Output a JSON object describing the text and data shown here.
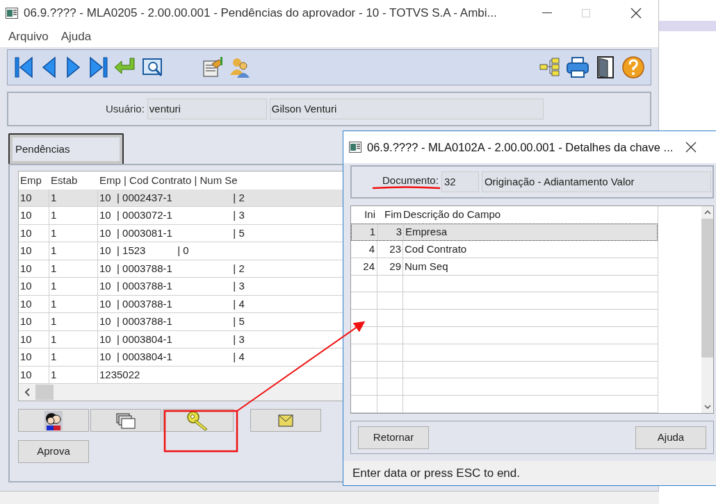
{
  "main_window": {
    "title": "06.9.???? - MLA0205 - 2.00.00.001 - Pendências do aprovador - 10 - TOTVS S.A - Ambi...",
    "menu": [
      "Arquivo",
      "Ajuda"
    ],
    "user": {
      "label": "Usuário:",
      "login": "venturi",
      "name": "Gilson Venturi"
    },
    "tabs": [
      {
        "label": "Pendências",
        "selected": true
      }
    ],
    "grid": {
      "columns": [
        "Emp",
        "Estab",
        "Emp | Cod Contrato | Num Se"
      ],
      "rows": [
        {
          "cells": [
            "10",
            "1",
            "10  | 0002437-1                     | 2"
          ],
          "selected": true
        },
        {
          "cells": [
            "10",
            "1",
            "10  | 0003072-1                     | 3"
          ],
          "selected": false
        },
        {
          "cells": [
            "10",
            "1",
            "10  | 0003081-1                     | 5"
          ],
          "selected": false
        },
        {
          "cells": [
            "10",
            "1",
            "10  | 1523           | 0"
          ],
          "selected": false
        },
        {
          "cells": [
            "10",
            "1",
            "10  | 0003788-1                     | 2"
          ],
          "selected": false
        },
        {
          "cells": [
            "10",
            "1",
            "10  | 0003788-1                     | 3"
          ],
          "selected": false
        },
        {
          "cells": [
            "10",
            "1",
            "10  | 0003788-1                     | 4"
          ],
          "selected": false
        },
        {
          "cells": [
            "10",
            "1",
            "10  | 0003788-1                     | 5"
          ],
          "selected": false
        },
        {
          "cells": [
            "10",
            "1",
            "10  | 0003804-1                     | 3"
          ],
          "selected": false
        },
        {
          "cells": [
            "10",
            "1",
            "10  | 0003804-1                     | 4"
          ],
          "selected": false
        },
        {
          "cells": [
            "10",
            "1",
            "1235022"
          ],
          "selected": false
        }
      ]
    },
    "action_buttons": [
      {
        "kind": "people"
      },
      {
        "kind": "folders"
      },
      {
        "kind": "key"
      },
      {
        "kind": "envelope"
      }
    ],
    "buttons": [
      "Aprova"
    ]
  },
  "dialog": {
    "title": "06.9.???? - MLA0102A - 2.00.00.001 - Detalhes da chave ...",
    "document": {
      "label": "Documento:",
      "code": "32",
      "description": "Originação - Adiantamento Valor"
    },
    "grid": {
      "columns": [
        "Ini",
        "Fim",
        "Descrição do Campo"
      ],
      "rows": [
        {
          "cells": [
            "1",
            "3",
            "Empresa"
          ],
          "selected": true
        },
        {
          "cells": [
            "4",
            "23",
            "Cod Contrato"
          ],
          "selected": false
        },
        {
          "cells": [
            "24",
            "29",
            "Num Seq"
          ],
          "selected": false
        }
      ]
    },
    "buttons": [
      "Retornar",
      "Ajuda"
    ],
    "status": "Enter data or press ESC to end."
  }
}
